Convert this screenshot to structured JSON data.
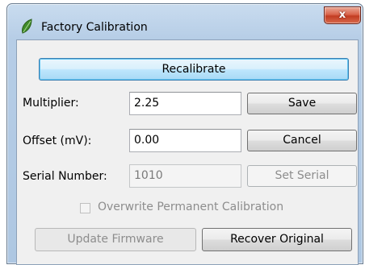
{
  "window": {
    "title": "Factory Calibration",
    "close_glyph": "x",
    "app_icon": "leaf-icon"
  },
  "buttons": {
    "recalibrate": "Recalibrate",
    "save": "Save",
    "cancel": "Cancel",
    "set_serial": "Set Serial",
    "update_firmware": "Update Firmware",
    "recover_original": "Recover Original"
  },
  "fields": {
    "multiplier": {
      "label": "Multiplier:",
      "value": "2.25"
    },
    "offset": {
      "label": "Offset (mV):",
      "value": "0.00"
    },
    "serial": {
      "label": "Serial Number:",
      "value": "1010"
    }
  },
  "options": {
    "overwrite_permanent": {
      "label": "Overwrite Permanent Calibration",
      "checked": false
    }
  },
  "colors": {
    "title_bar": "#b6cde6",
    "close_button": "#c9452a",
    "default_button": "#bee6fd",
    "dialog_background": "#f0f0f0"
  }
}
